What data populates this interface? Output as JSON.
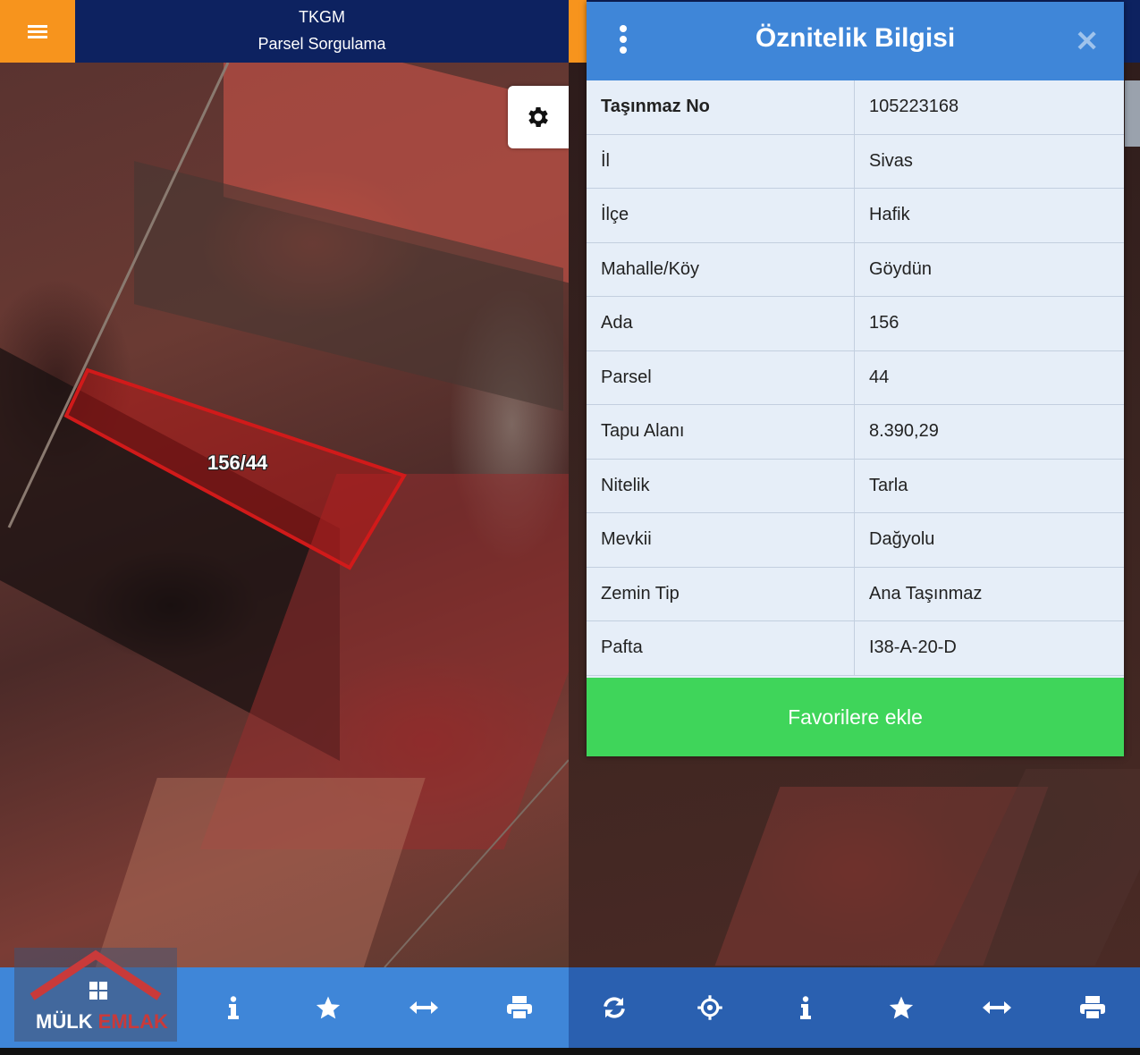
{
  "left_header": {
    "title": "TKGM",
    "subtitle": "Parsel Sorgulama",
    "menu_icon": "hamburger-icon"
  },
  "map": {
    "parcel_label": "156/44",
    "settings_icon": "gear-icon"
  },
  "watermark": {
    "brand_left": "MÜLK",
    "brand_right": "EMLAK"
  },
  "left_toolbar": [
    "info-icon",
    "star-icon",
    "swap-horizontal-icon",
    "print-icon"
  ],
  "dialog": {
    "title": "Öznitelik Bilgisi",
    "menu_icon": "kebab-menu-icon",
    "close_icon": "close-icon",
    "rows": [
      {
        "key": "Taşınmaz No",
        "value": "105223168"
      },
      {
        "key": "İl",
        "value": "Sivas"
      },
      {
        "key": "İlçe",
        "value": "Hafik"
      },
      {
        "key": "Mahalle/Köy",
        "value": "Göydün"
      },
      {
        "key": "Ada",
        "value": "156"
      },
      {
        "key": "Parsel",
        "value": "44"
      },
      {
        "key": "Tapu Alanı",
        "value": "8.390,29"
      },
      {
        "key": "Nitelik",
        "value": "Tarla"
      },
      {
        "key": "Mevkii",
        "value": "Dağyolu"
      },
      {
        "key": "Zemin Tip",
        "value": "Ana Taşınmaz"
      },
      {
        "key": "Pafta",
        "value": "I38-A-20-D"
      }
    ],
    "favorite_button": "Favorilere ekle"
  },
  "right_toolbar": [
    "refresh-icon",
    "crosshair-icon",
    "info-icon",
    "star-icon",
    "swap-horizontal-icon",
    "print-icon"
  ],
  "colors": {
    "header_navy": "#0d2260",
    "menu_orange": "#f7941d",
    "toolbar_blue": "#3f86d8",
    "favorite_green": "#3fd55a",
    "parcel_red": "#d11a1a"
  }
}
